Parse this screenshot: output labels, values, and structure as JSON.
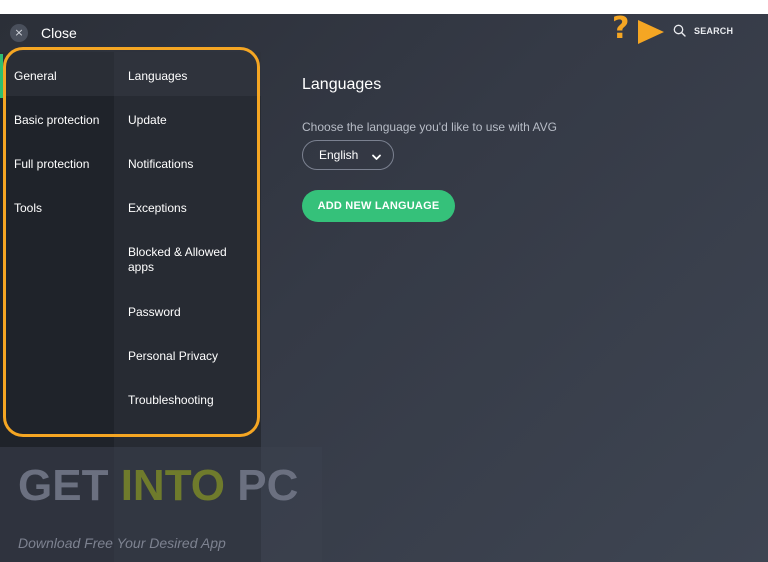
{
  "topbar": {
    "close_label": "Close",
    "close_icon_glyph": "×",
    "help_glyph": "?",
    "search_label": "SEARCH"
  },
  "sidebar": {
    "primary": [
      {
        "label": "General",
        "active": true
      },
      {
        "label": "Basic protection",
        "active": false
      },
      {
        "label": "Full protection",
        "active": false
      },
      {
        "label": "Tools",
        "active": false
      }
    ],
    "secondary": [
      {
        "label": "Languages",
        "active": true
      },
      {
        "label": "Update",
        "active": false
      },
      {
        "label": "Notifications",
        "active": false
      },
      {
        "label": "Exceptions",
        "active": false
      },
      {
        "label": "Blocked & Allowed apps",
        "active": false
      },
      {
        "label": "Password",
        "active": false
      },
      {
        "label": "Personal Privacy",
        "active": false
      },
      {
        "label": "Troubleshooting",
        "active": false
      }
    ]
  },
  "main": {
    "title": "Languages",
    "description": "Choose the language you'd like to use with AVG",
    "language_select": {
      "value": "English"
    },
    "add_button_label": "ADD NEW LANGUAGE"
  },
  "watermark": {
    "title_part1": "GET ",
    "title_part2": "INTO",
    "title_part3": " PC",
    "subtitle": "Download Free Your Desired App"
  },
  "colors": {
    "accent_green": "#35c17a",
    "annotation_orange": "#f5a623",
    "background": "#353a46"
  }
}
